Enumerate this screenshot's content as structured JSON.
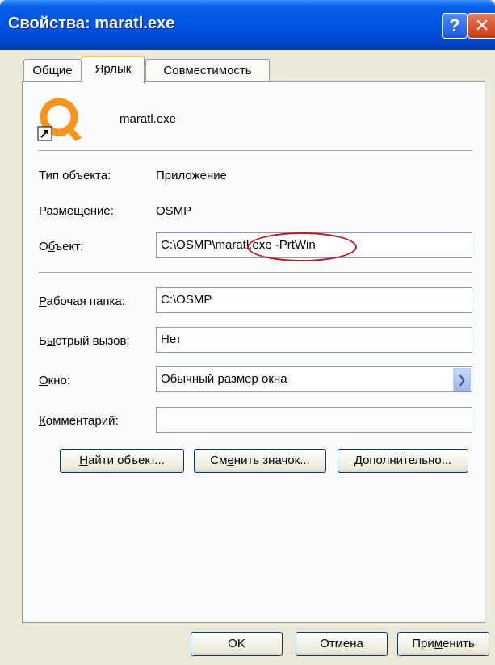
{
  "window": {
    "title": "Свойства: maratl.exe",
    "help_glyph": "?",
    "close_glyph": "✕"
  },
  "tabs": [
    {
      "label": "Общие"
    },
    {
      "label": "Ярлык"
    },
    {
      "label": "Совместимость"
    }
  ],
  "shortcut": {
    "file_name": "maratl.exe",
    "icon": "qiwi-q-shortcut-icon",
    "type_label": "Тип объекта:",
    "type_value": "Приложение",
    "location_label": "Размещение:",
    "location_value": "OSMP",
    "target_label_pre": "О",
    "target_label_u": "б",
    "target_label_post": "ъект:",
    "target_value": "C:\\OSMP\\maratl.exe -PrtWin",
    "workdir_label_u": "Р",
    "workdir_label_post": "абочая папка:",
    "workdir_value": "C:\\OSMP",
    "hotkey_label_pre": "Б",
    "hotkey_label_u": "ы",
    "hotkey_label_post": "стрый вызов:",
    "hotkey_value": "Нет",
    "window_label_u": "О",
    "window_label_post": "кно:",
    "window_value": "Обычный размер окна",
    "comment_label_u": "К",
    "comment_label_post": "омментарий:",
    "comment_value": ""
  },
  "buttons": {
    "find_u": "Н",
    "find_post": "айти объект...",
    "change_pre": "См",
    "change_u": "е",
    "change_post": "нить значок...",
    "advanced_u": "Д",
    "advanced_post": "ополнительно...",
    "ok": "OK",
    "cancel": "Отмена",
    "apply_pre": "При",
    "apply_u": "м",
    "apply_post": "енить"
  },
  "colors": {
    "titlebar": "#0054e3",
    "annotation_ellipse": "#c0181e",
    "qiwi_orange": "#f7941d"
  }
}
